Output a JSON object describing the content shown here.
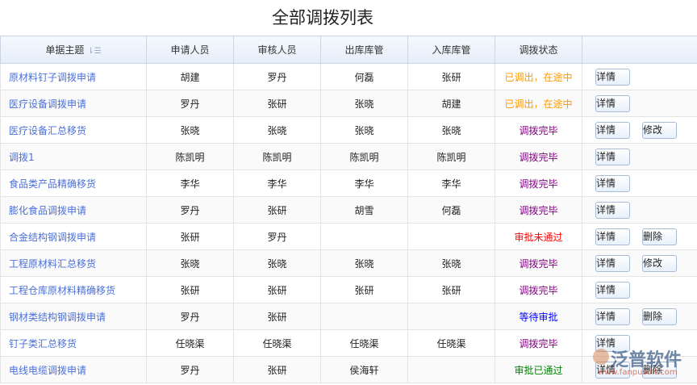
{
  "title": "全部调拨列表",
  "headers": [
    "单据主题",
    "申请人员",
    "审核人员",
    "出库库管",
    "入库库管",
    "调拨状态",
    ""
  ],
  "sort_icon": "sort-icon",
  "status_colors": {
    "已调出，在途中": "#ff9900",
    "调拨完毕": "#800080",
    "审批未通过": "#ff0000",
    "等待审批": "#0000ff",
    "审批已通过": "#008000"
  },
  "rows": [
    {
      "subject": "原材料钉子调拨申请",
      "applicant": "胡建",
      "reviewer": "罗丹",
      "out": "何磊",
      "in": "张研",
      "status": "已调出，在途中",
      "buttons": [
        "详情"
      ]
    },
    {
      "subject": "医疗设备调拨申请",
      "applicant": "罗丹",
      "reviewer": "张研",
      "out": "张晓",
      "in": "胡建",
      "status": "已调出，在途中",
      "buttons": [
        "详情"
      ]
    },
    {
      "subject": "医疗设备汇总移货",
      "applicant": "张晓",
      "reviewer": "张晓",
      "out": "张晓",
      "in": "张晓",
      "status": "调拨完毕",
      "buttons": [
        "详情",
        "修改"
      ]
    },
    {
      "subject": "调拨1",
      "applicant": "陈凯明",
      "reviewer": "陈凯明",
      "out": "陈凯明",
      "in": "陈凯明",
      "status": "调拨完毕",
      "buttons": [
        "详情"
      ]
    },
    {
      "subject": "食品类产品精确移货",
      "applicant": "李华",
      "reviewer": "李华",
      "out": "李华",
      "in": "李华",
      "status": "调拨完毕",
      "buttons": [
        "详情"
      ]
    },
    {
      "subject": "膨化食品调拨申请",
      "applicant": "罗丹",
      "reviewer": "张研",
      "out": "胡雪",
      "in": "何磊",
      "status": "调拨完毕",
      "buttons": [
        "详情"
      ]
    },
    {
      "subject": "合金结构钢调拨申请",
      "applicant": "张研",
      "reviewer": "罗丹",
      "out": "",
      "in": "",
      "status": "审批未通过",
      "buttons": [
        "详情",
        "删除"
      ]
    },
    {
      "subject": "工程原材料汇总移货",
      "applicant": "张晓",
      "reviewer": "张晓",
      "out": "张晓",
      "in": "张晓",
      "status": "调拨完毕",
      "buttons": [
        "详情",
        "修改"
      ]
    },
    {
      "subject": "工程仓库原材料精确移货",
      "applicant": "张研",
      "reviewer": "张研",
      "out": "张研",
      "in": "张研",
      "status": "调拨完毕",
      "buttons": [
        "详情"
      ]
    },
    {
      "subject": "钢材类结构钢调拨申请",
      "applicant": "罗丹",
      "reviewer": "张研",
      "out": "",
      "in": "",
      "status": "等待审批",
      "buttons": [
        "详情",
        "删除"
      ]
    },
    {
      "subject": "钉子类汇总移货",
      "applicant": "任晓渠",
      "reviewer": "任晓渠",
      "out": "任晓渠",
      "in": "任晓渠",
      "status": "调拨完毕",
      "buttons": [
        "详情"
      ]
    },
    {
      "subject": "电线电缆调拨申请",
      "applicant": "罗丹",
      "reviewer": "张研",
      "out": "侯海轩",
      "in": "",
      "status": "审批已通过",
      "buttons": [
        "详情",
        "删除"
      ]
    }
  ],
  "watermark": {
    "name": "泛普软件",
    "url": "www.fanpusoft.com"
  }
}
